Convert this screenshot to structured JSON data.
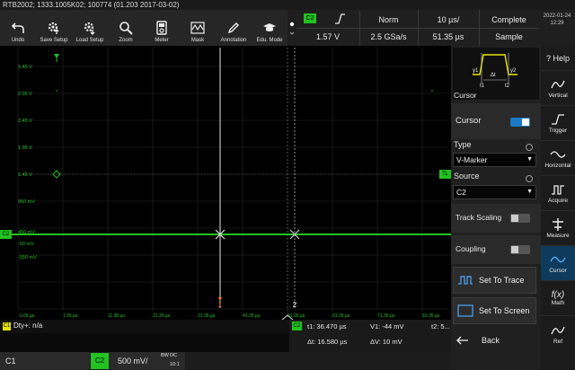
{
  "title": "RTB2002; 1333.1005K02; 100774 (01.203 2017-03-02)",
  "toolbar": {
    "undo": "Undo",
    "save_setup": "Save Setup",
    "load_setup": "Load Setup",
    "zoom": "Zoom",
    "meter": "Meter",
    "mask": "Mask",
    "annotation": "Annotation",
    "edu_mode": "Edu. Mode"
  },
  "trigger": {
    "channel": "C2",
    "level": "1.57 V",
    "mode": "Norm",
    "sample_rate": "2.5 GSa/s",
    "timebase": "10 µs/",
    "position": "51.35 µs",
    "state": "Complete",
    "acq_mode": "Sample"
  },
  "clock": {
    "date": "2022-01-24",
    "time": "12:29"
  },
  "y_labels": [
    "1.45 V",
    "2.05 V",
    "2.45 V",
    "1.95 V",
    "1.45 V",
    "950 mV",
    "450 mV",
    "-50 mV",
    "-550 mV"
  ],
  "x_labels": [
    "-1.05 µs",
    "1.35 µs",
    "11.35 µs",
    "21.35 µs",
    "31.35 µs",
    "41.35 µs",
    "51.35 µs",
    "61.35 µs",
    "71.35 µs",
    "81.35 µs"
  ],
  "markers": {
    "trigger_level": "TL",
    "cursor1": "1",
    "cursor2": "2",
    "channel": "C2"
  },
  "panel": {
    "title": "Cursor",
    "diagram": {
      "y1": "y1",
      "y2": "y2",
      "t1": "t1",
      "t2": "t2",
      "dt": "Δt"
    },
    "cursor_label": "Cursor",
    "type_label": "Type",
    "type_value": "V-Marker",
    "source_label": "Source",
    "source_value": "C2",
    "track_scaling": "Track Scaling",
    "coupling": "Coupling",
    "set_to_trace": "Set To Trace",
    "set_to_screen": "Set To Screen",
    "back": "Back"
  },
  "sidebar": [
    "Help",
    "Vertical",
    "Trigger",
    "Horizontal",
    "Acquire",
    "Measure",
    "Cursor",
    "Math",
    "Ref"
  ],
  "measurement": {
    "channel": "C1",
    "text": "Dty+: n/a"
  },
  "cursor_readout": {
    "channel": "C2",
    "t1": "t1: 36.470 µs",
    "v1": "V1: -44 mV",
    "t2": "t2: 5...",
    "dt": "Δt: 16.580 µs",
    "dv": "ΔV: 10 mV"
  },
  "channels": {
    "c1": "C1",
    "c2": "C2",
    "c2_scale": "500 mV/",
    "c2_coupling_top": "BW",
    "c2_coupling": "DC",
    "c2_extra": "10:1"
  },
  "colors": {
    "channel2": "#22c222",
    "trigger_yellow": "#e6e600",
    "accent_blue": "#1a7ac8",
    "cursor_orange": "#ff7a1a"
  }
}
